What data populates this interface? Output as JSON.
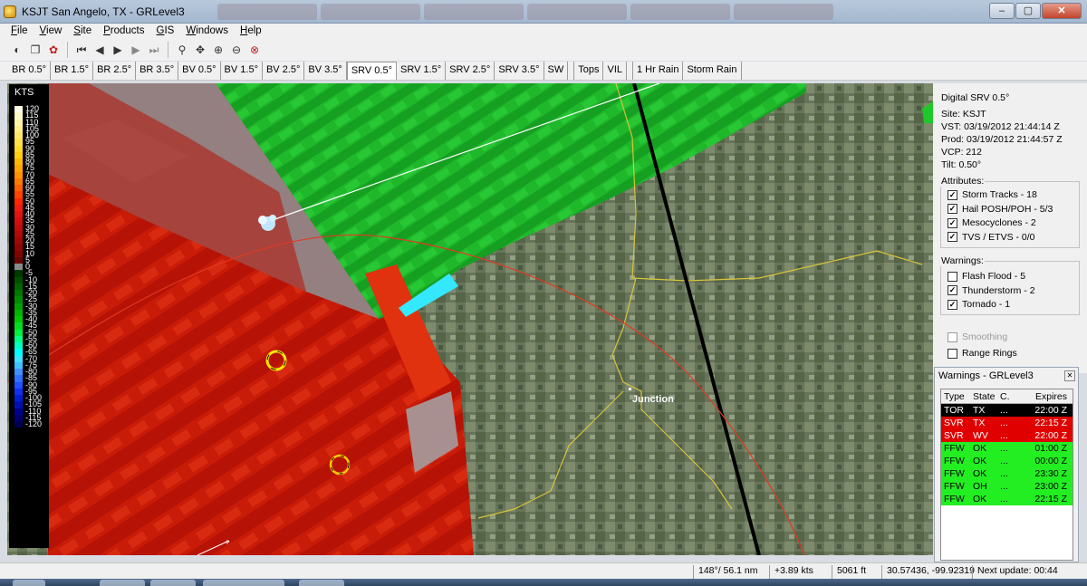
{
  "window": {
    "title": "KSJT San Angelo, TX - GRLevel3",
    "controls": [
      "–",
      "▢",
      "✕"
    ]
  },
  "menu": [
    "File",
    "View",
    "Site",
    "Products",
    "GIS",
    "Windows",
    "Help"
  ],
  "product_tabs": [
    {
      "label": "BR 0.5°",
      "active": false
    },
    {
      "label": "BR 1.5°",
      "active": false
    },
    {
      "label": "BR 2.5°",
      "active": false
    },
    {
      "label": "BR 3.5°",
      "active": false
    },
    {
      "label": "BV 0.5°",
      "active": false
    },
    {
      "label": "BV 1.5°",
      "active": false
    },
    {
      "label": "BV 2.5°",
      "active": false
    },
    {
      "label": "BV 3.5°",
      "active": false
    },
    {
      "label": "SRV 0.5°",
      "active": true
    },
    {
      "label": "SRV 1.5°",
      "active": false
    },
    {
      "label": "SRV 2.5°",
      "active": false
    },
    {
      "label": "SRV 3.5°",
      "active": false
    },
    {
      "label": "SW",
      "active": false
    },
    {
      "label": "Tops",
      "active": false
    },
    {
      "label": "VIL",
      "active": false
    },
    {
      "label": "1 Hr Rain",
      "active": false
    },
    {
      "label": "Storm Rain",
      "active": false
    }
  ],
  "legend": {
    "unit": "KTS",
    "labels": [
      "120",
      "115",
      "110",
      "105",
      "100",
      "95",
      "90",
      "85",
      "80",
      "75",
      "70",
      "65",
      "60",
      "55",
      "50",
      "45",
      "40",
      "35",
      "30",
      "25",
      "20",
      "15",
      "10",
      "5",
      "0",
      "-5",
      "-10",
      "-15",
      "-20",
      "-25",
      "-30",
      "-35",
      "-40",
      "-45",
      "-50",
      "-55",
      "-60",
      "-65",
      "-70",
      "-75",
      "-80",
      "-85",
      "-90",
      "-95",
      "-100",
      "-105",
      "-110",
      "-115",
      "-120"
    ],
    "colors": [
      "#fffde8",
      "#fff8c8",
      "#fff3a8",
      "#ffee88",
      "#ffe868",
      "#ffe048",
      "#ffd828",
      "#ffcc10",
      "#ffb800",
      "#ffa400",
      "#ff9000",
      "#ff7800",
      "#ff6000",
      "#ff4400",
      "#ff2800",
      "#f01c10",
      "#e01410",
      "#d01010",
      "#c00c0c",
      "#b00a0a",
      "#a00808",
      "#900606",
      "#800404",
      "#6a0303",
      "#8a8a8a",
      "#003a00",
      "#005000",
      "#006400",
      "#007800",
      "#008c00",
      "#00a000",
      "#00b400",
      "#00c800",
      "#00dc20",
      "#00f040",
      "#00ff80",
      "#00ffc0",
      "#00ffff",
      "#40e0ff",
      "#40c0ff",
      "#4090ff",
      "#3070ff",
      "#2050ff",
      "#1030f0",
      "#0020d0",
      "#0010b0",
      "#000090",
      "#000070",
      "#000050"
    ]
  },
  "info_panel": {
    "product": "Digital SRV 0.5°",
    "site": "Site:  KSJT",
    "vst": "VST: 03/19/2012  21:44:14 Z",
    "prod": "Prod: 03/19/2012  21:44:57 Z",
    "vcp": "VCP:  212",
    "tilt": "Tilt:  0.50°",
    "attributes_title": "Attributes:",
    "attributes": [
      {
        "label": "Storm Tracks - 18",
        "checked": true
      },
      {
        "label": "Hail POSH/POH - 5/3",
        "checked": true
      },
      {
        "label": "Mesocyclones - 2",
        "checked": true
      },
      {
        "label": "TVS / ETVS - 0/0",
        "checked": true
      }
    ],
    "warnings_title": "Warnings:",
    "warnings": [
      {
        "label": "Flash Flood - 5",
        "checked": false
      },
      {
        "label": "Thunderstorm - 2",
        "checked": true
      },
      {
        "label": "Tornado - 1",
        "checked": true
      }
    ],
    "smoothing": "Smoothing",
    "range_rings": "Range Rings"
  },
  "warnings_window": {
    "title": "Warnings - GRLevel3",
    "headers": [
      "Type",
      "State",
      "C.",
      "Expires"
    ],
    "rows": [
      {
        "type": "TOR",
        "state": "TX",
        "county": "...",
        "expires": "22:00 Z",
        "bg": "#000000",
        "fg": "#ffffff"
      },
      {
        "type": "SVR",
        "state": "TX",
        "county": "...",
        "expires": "22:15 Z",
        "bg": "#e00000",
        "fg": "#ffffff"
      },
      {
        "type": "SVR",
        "state": "WV",
        "county": "...",
        "expires": "22:00 Z",
        "bg": "#e00000",
        "fg": "#ffffff"
      },
      {
        "type": "FFW",
        "state": "OK",
        "county": "...",
        "expires": "01:00 Z",
        "bg": "#22ee22",
        "fg": "#000000"
      },
      {
        "type": "FFW",
        "state": "OK",
        "county": "...",
        "expires": "00:00 Z",
        "bg": "#22ee22",
        "fg": "#000000"
      },
      {
        "type": "FFW",
        "state": "OK",
        "county": "...",
        "expires": "23:30 Z",
        "bg": "#22ee22",
        "fg": "#000000"
      },
      {
        "type": "FFW",
        "state": "OH",
        "county": "...",
        "expires": "23:00 Z",
        "bg": "#22ee22",
        "fg": "#000000"
      },
      {
        "type": "FFW",
        "state": "OK",
        "county": "...",
        "expires": "22:15 Z",
        "bg": "#22ee22",
        "fg": "#000000"
      }
    ]
  },
  "map": {
    "city_label": "Junction"
  },
  "status": {
    "azimuth_range": "148°/ 56.1 nm",
    "velocity": "+3.89 kts",
    "height": "5061 ft",
    "latlon": "30.57436, -99.92319",
    "next_update": "Next update: 00:44"
  },
  "toolbar_icons": [
    "loop-icon",
    "copy-icon",
    "palette-icon",
    "first-frame-icon",
    "prev-frame-icon",
    "play-icon",
    "next-frame-icon",
    "last-frame-icon",
    "zoom-icon",
    "pan-icon",
    "zoom-in-icon",
    "zoom-out-icon",
    "zoom-reset-icon"
  ]
}
